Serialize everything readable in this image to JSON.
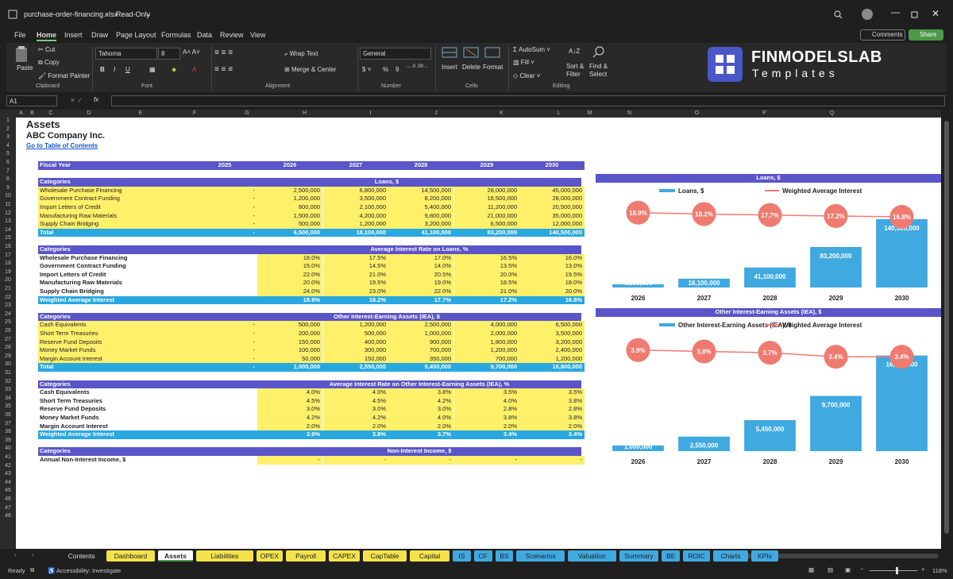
{
  "title": {
    "file": "purchase-order-financing.xlsx",
    "mode": "Read-Only"
  },
  "menu": [
    "File",
    "Home",
    "Insert",
    "Draw",
    "Page Layout",
    "Formulas",
    "Data",
    "Review",
    "View"
  ],
  "menu_right": {
    "comments": "Comments",
    "share": "Share"
  },
  "ribbon": {
    "paste": "Paste",
    "cut": "Cut",
    "copy": "Copy",
    "format_painter": "Format Painter",
    "clipboard": "Clipboard",
    "font_name": "Tahoma",
    "font_size": "8",
    "font": "Font",
    "wrap": "Wrap Text",
    "merge": "Merge & Center",
    "alignment": "Alignment",
    "number_format": "General",
    "number": "Number",
    "insert": "Insert",
    "delete": "Delete",
    "format": "Format",
    "cells": "Cells",
    "autosum": "AutoSum",
    "fill": "Fill",
    "clear": "Clear",
    "sort": "Sort &",
    "filter": "Filter",
    "find": "Find &",
    "select": "Select",
    "editing": "Editing",
    "bold": "B",
    "italic": "I",
    "underline": "U",
    "pct": "%",
    "comma": "9"
  },
  "brand": {
    "name": "FINMODELSLAB",
    "sub": "Templates"
  },
  "formula": {
    "cell_ref": "A1",
    "fx": "fx",
    "value": ""
  },
  "columns": [
    "A",
    "B",
    "C",
    "D",
    "E",
    "F",
    "G",
    "H",
    "I",
    "J",
    "K",
    "L",
    "M",
    "N",
    "O",
    "P",
    "Q"
  ],
  "sheet": {
    "title": "Assets",
    "company": "ABC Company Inc.",
    "toc": "Go to Table of Contents",
    "fiscal_label": "Fiscal Year",
    "years": [
      "2025",
      "2026",
      "2027",
      "2028",
      "2029",
      "2030"
    ],
    "categories": "Categories",
    "loans": {
      "header": "Loans, $",
      "rows": [
        {
          "name": "Wholesale Purchase Financing",
          "v": [
            "-",
            "2,500,000",
            "6,800,000",
            "14,500,000",
            "28,000,000",
            "45,000,000"
          ]
        },
        {
          "name": "Government Contract Funding",
          "v": [
            "-",
            "1,200,000",
            "3,500,000",
            "8,200,000",
            "16,500,000",
            "28,000,000"
          ]
        },
        {
          "name": "Import Letters of Credit",
          "v": [
            "-",
            "800,000",
            "2,100,000",
            "5,400,000",
            "11,200,000",
            "20,500,000"
          ]
        },
        {
          "name": "Manufacturing Raw Materials",
          "v": [
            "-",
            "1,500,000",
            "4,200,000",
            "9,800,000",
            "21,000,000",
            "35,000,000"
          ]
        },
        {
          "name": "Supply Chain Bridging",
          "v": [
            "-",
            "500,000",
            "1,200,000",
            "3,200,000",
            "6,500,000",
            "12,000,000"
          ]
        }
      ],
      "total": {
        "name": "Total",
        "v": [
          "-",
          "6,500,000",
          "18,100,000",
          "41,100,000",
          "83,200,000",
          "140,500,000"
        ]
      }
    },
    "rates": {
      "header": "Average Interest Rate on Loans, %",
      "rows": [
        {
          "name": "Wholesale Purchase Financing",
          "v": [
            "18.0%",
            "17.5%",
            "17.0%",
            "16.5%",
            "16.0%"
          ]
        },
        {
          "name": "Government Contract Funding",
          "v": [
            "15.0%",
            "14.5%",
            "14.0%",
            "13.5%",
            "13.0%"
          ]
        },
        {
          "name": "Import Letters of Credit",
          "v": [
            "22.0%",
            "21.0%",
            "20.5%",
            "20.0%",
            "19.5%"
          ]
        },
        {
          "name": "Manufacturing Raw Materials",
          "v": [
            "20.0%",
            "19.5%",
            "19.0%",
            "18.5%",
            "18.0%"
          ]
        },
        {
          "name": "Supply Chain Bridging",
          "v": [
            "24.0%",
            "23.0%",
            "22.0%",
            "21.0%",
            "20.0%"
          ]
        }
      ],
      "wavg": {
        "name": "Weighted Average Interest",
        "v": [
          "18.9%",
          "18.2%",
          "17.7%",
          "17.2%",
          "16.8%"
        ]
      }
    },
    "iea": {
      "header": "Other Interest-Earning Assets (IEA), $",
      "rows": [
        {
          "name": "Cash Equivalents",
          "v": [
            "-",
            "500,000",
            "1,200,000",
            "2,500,000",
            "4,000,000",
            "6,500,000"
          ]
        },
        {
          "name": "Short Term Treasuries",
          "v": [
            "-",
            "200,000",
            "500,000",
            "1,000,000",
            "2,000,000",
            "3,500,000"
          ]
        },
        {
          "name": "Reserve Fund Deposits",
          "v": [
            "-",
            "150,000",
            "400,000",
            "900,000",
            "1,800,000",
            "3,200,000"
          ]
        },
        {
          "name": "Money Market Funds",
          "v": [
            "-",
            "100,000",
            "300,000",
            "700,000",
            "1,200,000",
            "2,400,000"
          ]
        },
        {
          "name": "Margin Account Interest",
          "v": [
            "-",
            "50,000",
            "150,000",
            "350,000",
            "700,000",
            "1,200,000"
          ]
        }
      ],
      "total": {
        "name": "Total",
        "v": [
          "-",
          "1,000,000",
          "2,550,000",
          "5,450,000",
          "9,700,000",
          "16,800,000"
        ]
      }
    },
    "iea_rates": {
      "header": "Average Interest Rate on Other Interest-Earning Assets (IEA), %",
      "rows": [
        {
          "name": "Cash Equivalents",
          "v": [
            "4.0%",
            "4.0%",
            "3.8%",
            "3.5%",
            "3.5%"
          ]
        },
        {
          "name": "Short Term Treasuries",
          "v": [
            "4.5%",
            "4.5%",
            "4.2%",
            "4.0%",
            "3.8%"
          ]
        },
        {
          "name": "Reserve Fund Deposits",
          "v": [
            "3.0%",
            "3.0%",
            "3.0%",
            "2.8%",
            "2.8%"
          ]
        },
        {
          "name": "Money Market Funds",
          "v": [
            "4.2%",
            "4.2%",
            "4.0%",
            "3.8%",
            "3.8%"
          ]
        },
        {
          "name": "Margin Account Interest",
          "v": [
            "2.0%",
            "2.0%",
            "2.0%",
            "2.0%",
            "2.0%"
          ]
        }
      ],
      "wavg": {
        "name": "Weighted Average Interest",
        "v": [
          "3.9%",
          "3.8%",
          "3.7%",
          "3.4%",
          "3.4%"
        ]
      }
    },
    "nii": {
      "header": "Non-Interest Income, $",
      "rows": [
        {
          "name": "Annual Non-Interest Income, $",
          "v": [
            "-",
            "-",
            "-",
            "-",
            "-"
          ]
        }
      ]
    }
  },
  "chart_data": [
    {
      "type": "bar",
      "title": "Loans, $",
      "categories": [
        "2026",
        "2027",
        "2028",
        "2029",
        "2030"
      ],
      "series": [
        {
          "name": "Loans, $",
          "values": [
            6500000,
            18100000,
            41100000,
            83200000,
            140500000
          ],
          "labels": [
            "6,500,000",
            "18,100,000",
            "41,100,000",
            "83,200,000",
            "140,500,000"
          ]
        },
        {
          "name": "Weighted Average Interest",
          "type": "line",
          "values": [
            18.9,
            18.2,
            17.7,
            17.2,
            16.8
          ],
          "labels": [
            "18.9%",
            "18.2%",
            "17.7%",
            "17.2%",
            "16.8%"
          ]
        }
      ],
      "bar_color": "#3fa9e0",
      "line_color": "#ef7b70",
      "legend": "top",
      "ylim": [
        0,
        150000000
      ],
      "y2lim": [
        0,
        22
      ]
    },
    {
      "type": "bar",
      "title": "Other Interest-Earning Assets (IEA), $",
      "categories": [
        "2026",
        "2027",
        "2028",
        "2029",
        "2030"
      ],
      "series": [
        {
          "name": "Other Interest-Earning Assets (IEA), $",
          "values": [
            1000000,
            2550000,
            5450000,
            9700000,
            16800000
          ],
          "labels": [
            "1,000,000",
            "2,550,000",
            "5,450,000",
            "9,700,000",
            "16,800,000"
          ]
        },
        {
          "name": "Weighted Average Interest",
          "type": "line",
          "values": [
            3.9,
            3.8,
            3.7,
            3.4,
            3.4
          ],
          "labels": [
            "3.9%",
            "3.8%",
            "3.7%",
            "3.4%",
            "3.4%"
          ]
        }
      ],
      "bar_color": "#3fa9e0",
      "line_color": "#ef7b70",
      "legend": "top",
      "ylim": [
        0,
        18000000
      ],
      "y2lim": [
        0,
        4.6
      ]
    }
  ],
  "tabs": [
    {
      "name": "Contents",
      "color": "#1f1f1f"
    },
    {
      "name": "Dashboard",
      "color": "#f4e24a"
    },
    {
      "name": "Assets",
      "color": "#ffffff",
      "active": true
    },
    {
      "name": "Liabilities",
      "color": "#f4e24a"
    },
    {
      "name": "OPEX",
      "color": "#f4e24a"
    },
    {
      "name": "Payroll",
      "color": "#f4e24a"
    },
    {
      "name": "CAPEX",
      "color": "#f4e24a"
    },
    {
      "name": "CapTable",
      "color": "#f4e24a"
    },
    {
      "name": "Capital",
      "color": "#f4e24a"
    },
    {
      "name": "IS",
      "color": "#3fa9e0"
    },
    {
      "name": "CF",
      "color": "#3fa9e0"
    },
    {
      "name": "BS",
      "color": "#3fa9e0"
    },
    {
      "name": "Scenarios",
      "color": "#3fa9e0"
    },
    {
      "name": "Valuation",
      "color": "#3fa9e0"
    },
    {
      "name": "Summary",
      "color": "#3fa9e0"
    },
    {
      "name": "BE",
      "color": "#3fa9e0"
    },
    {
      "name": "ROIC",
      "color": "#3fa9e0"
    },
    {
      "name": "Charts",
      "color": "#3fa9e0"
    },
    {
      "name": "KPIs",
      "color": "#3fa9e0"
    }
  ],
  "status": {
    "ready": "Ready",
    "accessibility": "Accessibility: Investigate",
    "zoom": "118%"
  }
}
